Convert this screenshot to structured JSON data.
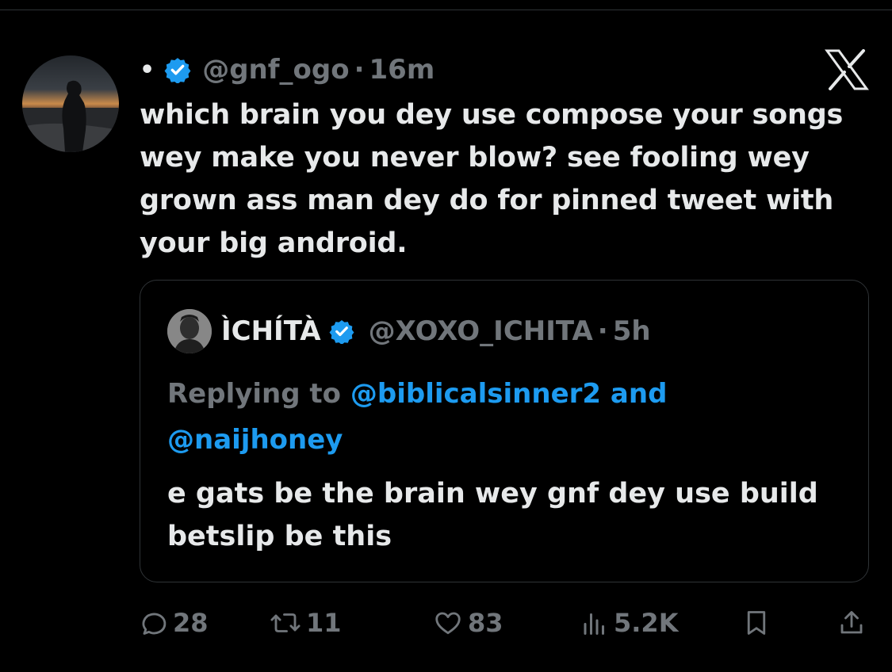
{
  "tweet": {
    "bullet": "•",
    "handle": "@gnf_ogo",
    "separator": "·",
    "time": "16m",
    "text": "which brain you dey use compose your songs wey make you never blow? see fooling wey grown ass man dey do for pinned tweet with your big android."
  },
  "quoted": {
    "name": "ÌCHÍTÀ",
    "handle": "@XOXO_ICHITA",
    "separator": "·",
    "time": "5h",
    "replying_prefix": "Replying to ",
    "mention_1": "@biblicalsinner2",
    "conjunction": " and",
    "mention_2": "@naijhoney",
    "text": "e gats be the brain wey gnf dey use build betslip be this"
  },
  "actions": {
    "replies": "28",
    "retweets": "11",
    "likes": "83",
    "views": "5.2K"
  },
  "colors": {
    "background": "#000000",
    "text": "#e7e9ea",
    "muted": "#71767b",
    "accent": "#1d9bf0",
    "border": "#2f3336"
  },
  "icons": {
    "brand": "x-logo-icon",
    "verified": "verified-badge-icon",
    "reply": "reply-icon",
    "retweet": "retweet-icon",
    "like": "heart-icon",
    "views": "views-icon",
    "bookmark": "bookmark-icon",
    "share": "share-icon"
  }
}
